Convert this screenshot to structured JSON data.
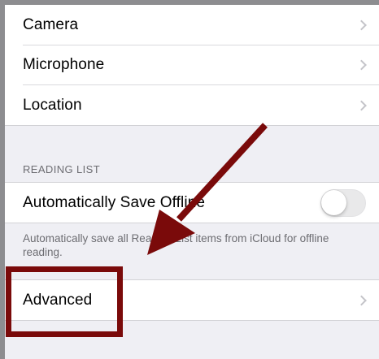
{
  "privacy_items": [
    {
      "label": "Camera"
    },
    {
      "label": "Microphone"
    },
    {
      "label": "Location"
    }
  ],
  "reading_list": {
    "header": "READING LIST",
    "auto_save_label": "Automatically Save Offline",
    "auto_save_enabled": false,
    "footer": "Automatically save all Reading List items from iCloud for offline reading."
  },
  "advanced": {
    "label": "Advanced"
  },
  "annotation": {
    "color": "#7a0a0a"
  }
}
